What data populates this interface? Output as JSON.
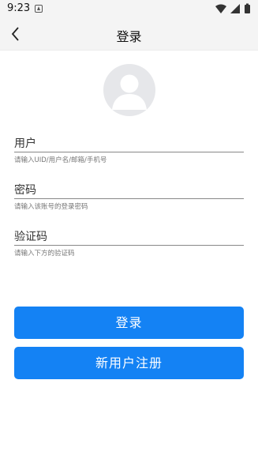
{
  "status_bar": {
    "time": "9:23",
    "notification_icon": "download-notification-icon",
    "icons": [
      "wifi-icon",
      "signal-icon",
      "battery-icon"
    ]
  },
  "header": {
    "back_icon": "back-arrow-icon",
    "title": "登录"
  },
  "avatar": {
    "icon": "default-avatar-icon"
  },
  "form": {
    "username": {
      "label": "用户",
      "value": "",
      "hint": "请输入UID/用户名/邮箱/手机号"
    },
    "password": {
      "label": "密码",
      "value": "",
      "hint": "请输入该账号的登录密码"
    },
    "captcha": {
      "label": "验证码",
      "value": "",
      "hint": "请输入下方的验证码"
    }
  },
  "buttons": {
    "login": "登录",
    "register": "新用户注册"
  },
  "colors": {
    "primary": "#1482f4",
    "header_bg": "#f4f4f4",
    "avatar_bg": "#e6e7ea"
  }
}
